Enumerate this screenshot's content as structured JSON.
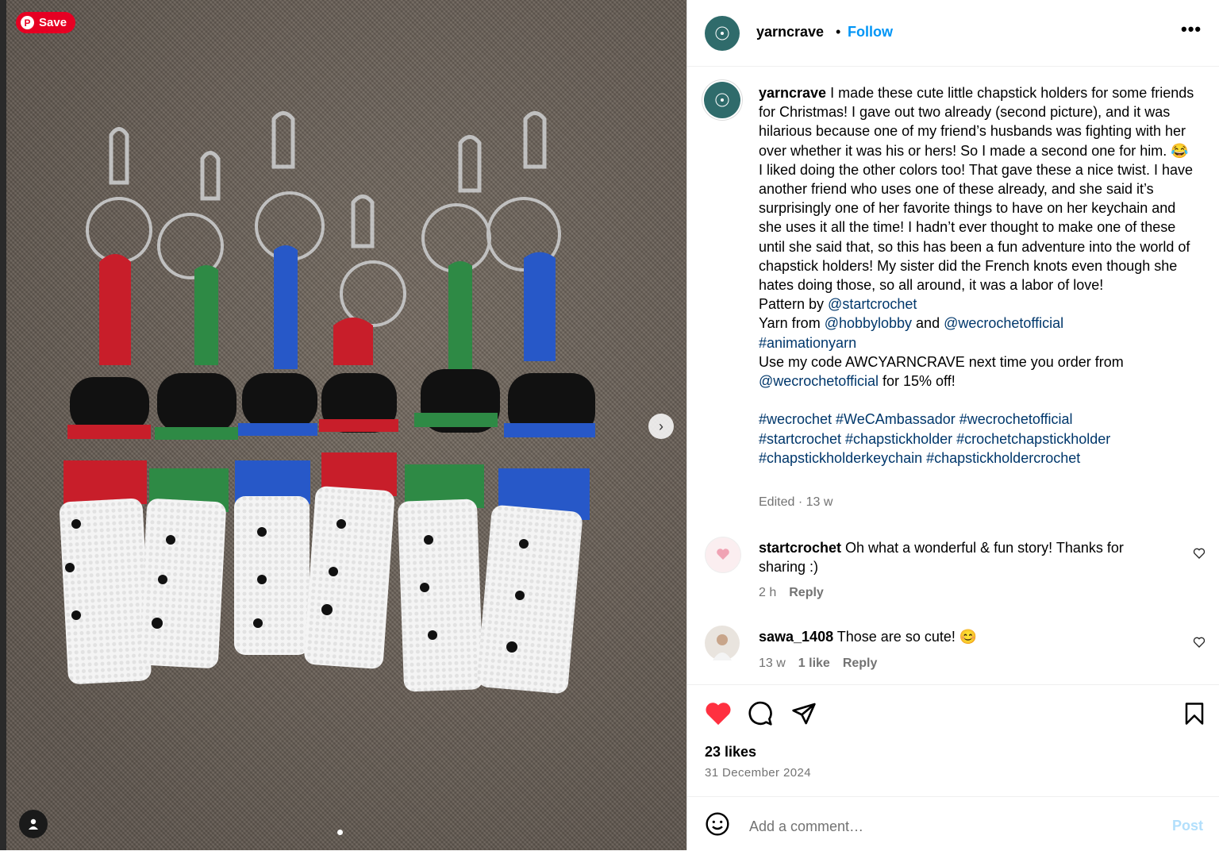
{
  "photo": {
    "save_label": "Save",
    "pin_glyph": "P",
    "next_glyph": "›"
  },
  "header": {
    "username": "yarncrave",
    "dot": "•",
    "follow_label": "Follow",
    "more_glyph": "•••"
  },
  "caption": {
    "username": "yarncrave",
    "body": " I made these cute little chapstick holders for some friends for Christmas! I gave out two already (second picture), and it was hilarious because one of my friend’s husbands was fighting with her over whether it was his or hers! So I made a second one for him. 😂 I liked doing the other colors too! That gave these a nice twist. I have another friend who uses one of these already, and she said it’s surprisingly one of her favorite things to have on her keychain and she uses it all the time! I hadn’t ever thought to make one of these until she said that, so this has been a fun adventure into the world of chapstick holders! My sister did the French knots even though she hates doing those, so all around, it was a labor of love!",
    "pattern_prefix": "Pattern by ",
    "pattern_link": "@startcrochet",
    "yarn_prefix": "Yarn from ",
    "yarn_link1": "@hobbylobby",
    "yarn_and": " and ",
    "yarn_link2": "@wecrochetofficial",
    "yarn_tag": "#animationyarn",
    "code_text": "Use my code AWCYARNCRAVE next time you order from ",
    "code_link": "@wecrochetofficial",
    "code_suffix": " for 15% off!",
    "hashtags_line1": "#wecrochet #WeCAmbassador #wecrochetofficial",
    "hashtags_line2": "#startcrochet #chapstickholder #crochetchapstickholder",
    "hashtags_line3": "#chapstickholderkeychain #chapstickholdercrochet",
    "edited": "Edited · 13 w"
  },
  "comments": [
    {
      "username": "startcrochet",
      "text": " Oh what a wonderful & fun story! Thanks for sharing :)",
      "time": "2 h",
      "reply": "Reply"
    },
    {
      "username": "sawa_1408",
      "text": " Those are so cute! 😊",
      "time": "13 w",
      "likes": "1 like",
      "reply": "Reply"
    }
  ],
  "footer": {
    "likes": "23 likes",
    "date": "31 December 2024",
    "comment_placeholder": "Add a comment…",
    "post_label": "Post"
  },
  "colors": {
    "accent": "#0095f6",
    "like": "#ff3040",
    "link": "#00376b",
    "pinterest": "#e60023"
  }
}
